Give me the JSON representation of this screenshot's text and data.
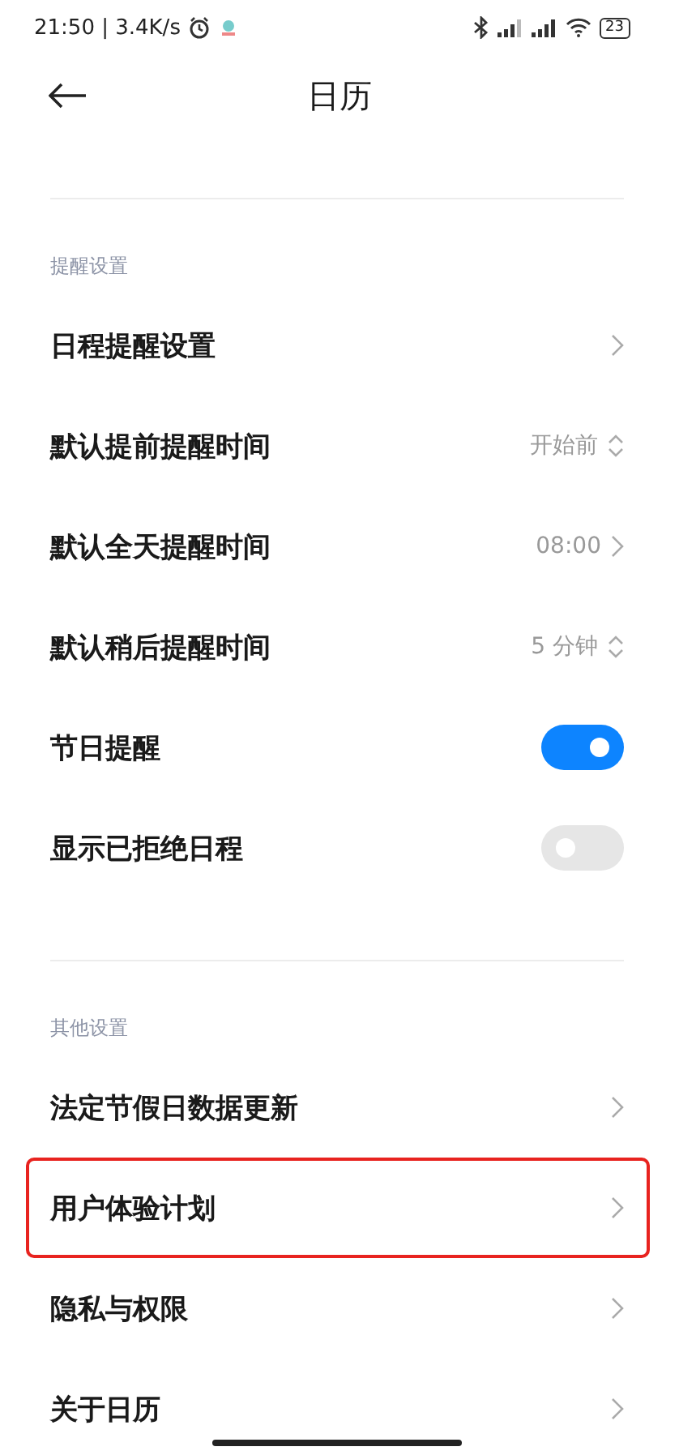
{
  "status_bar": {
    "text": "21:50 | 3.4K/s",
    "battery": "23"
  },
  "header": {
    "title": "日历"
  },
  "sections": [
    {
      "title": "提醒设置",
      "items": [
        {
          "label": "日程提醒设置",
          "kind": "link",
          "highlighted": false
        },
        {
          "label": "默认提前提醒时间",
          "kind": "select",
          "value": "开始前",
          "highlighted": false
        },
        {
          "label": "默认全天提醒时间",
          "kind": "link",
          "value": "08:00",
          "highlighted": false
        },
        {
          "label": "默认稍后提醒时间",
          "kind": "select",
          "value": "5 分钟",
          "highlighted": false
        },
        {
          "label": "节日提醒",
          "kind": "toggle",
          "on": true,
          "highlighted": false
        },
        {
          "label": "显示已拒绝日程",
          "kind": "toggle",
          "on": false,
          "highlighted": false
        }
      ]
    },
    {
      "title": "其他设置",
      "items": [
        {
          "label": "法定节假日数据更新",
          "kind": "link",
          "highlighted": false
        },
        {
          "label": "用户体验计划",
          "kind": "link",
          "highlighted": true
        },
        {
          "label": "隐私与权限",
          "kind": "link",
          "highlighted": false
        },
        {
          "label": "关于日历",
          "kind": "link",
          "highlighted": false
        }
      ]
    }
  ]
}
